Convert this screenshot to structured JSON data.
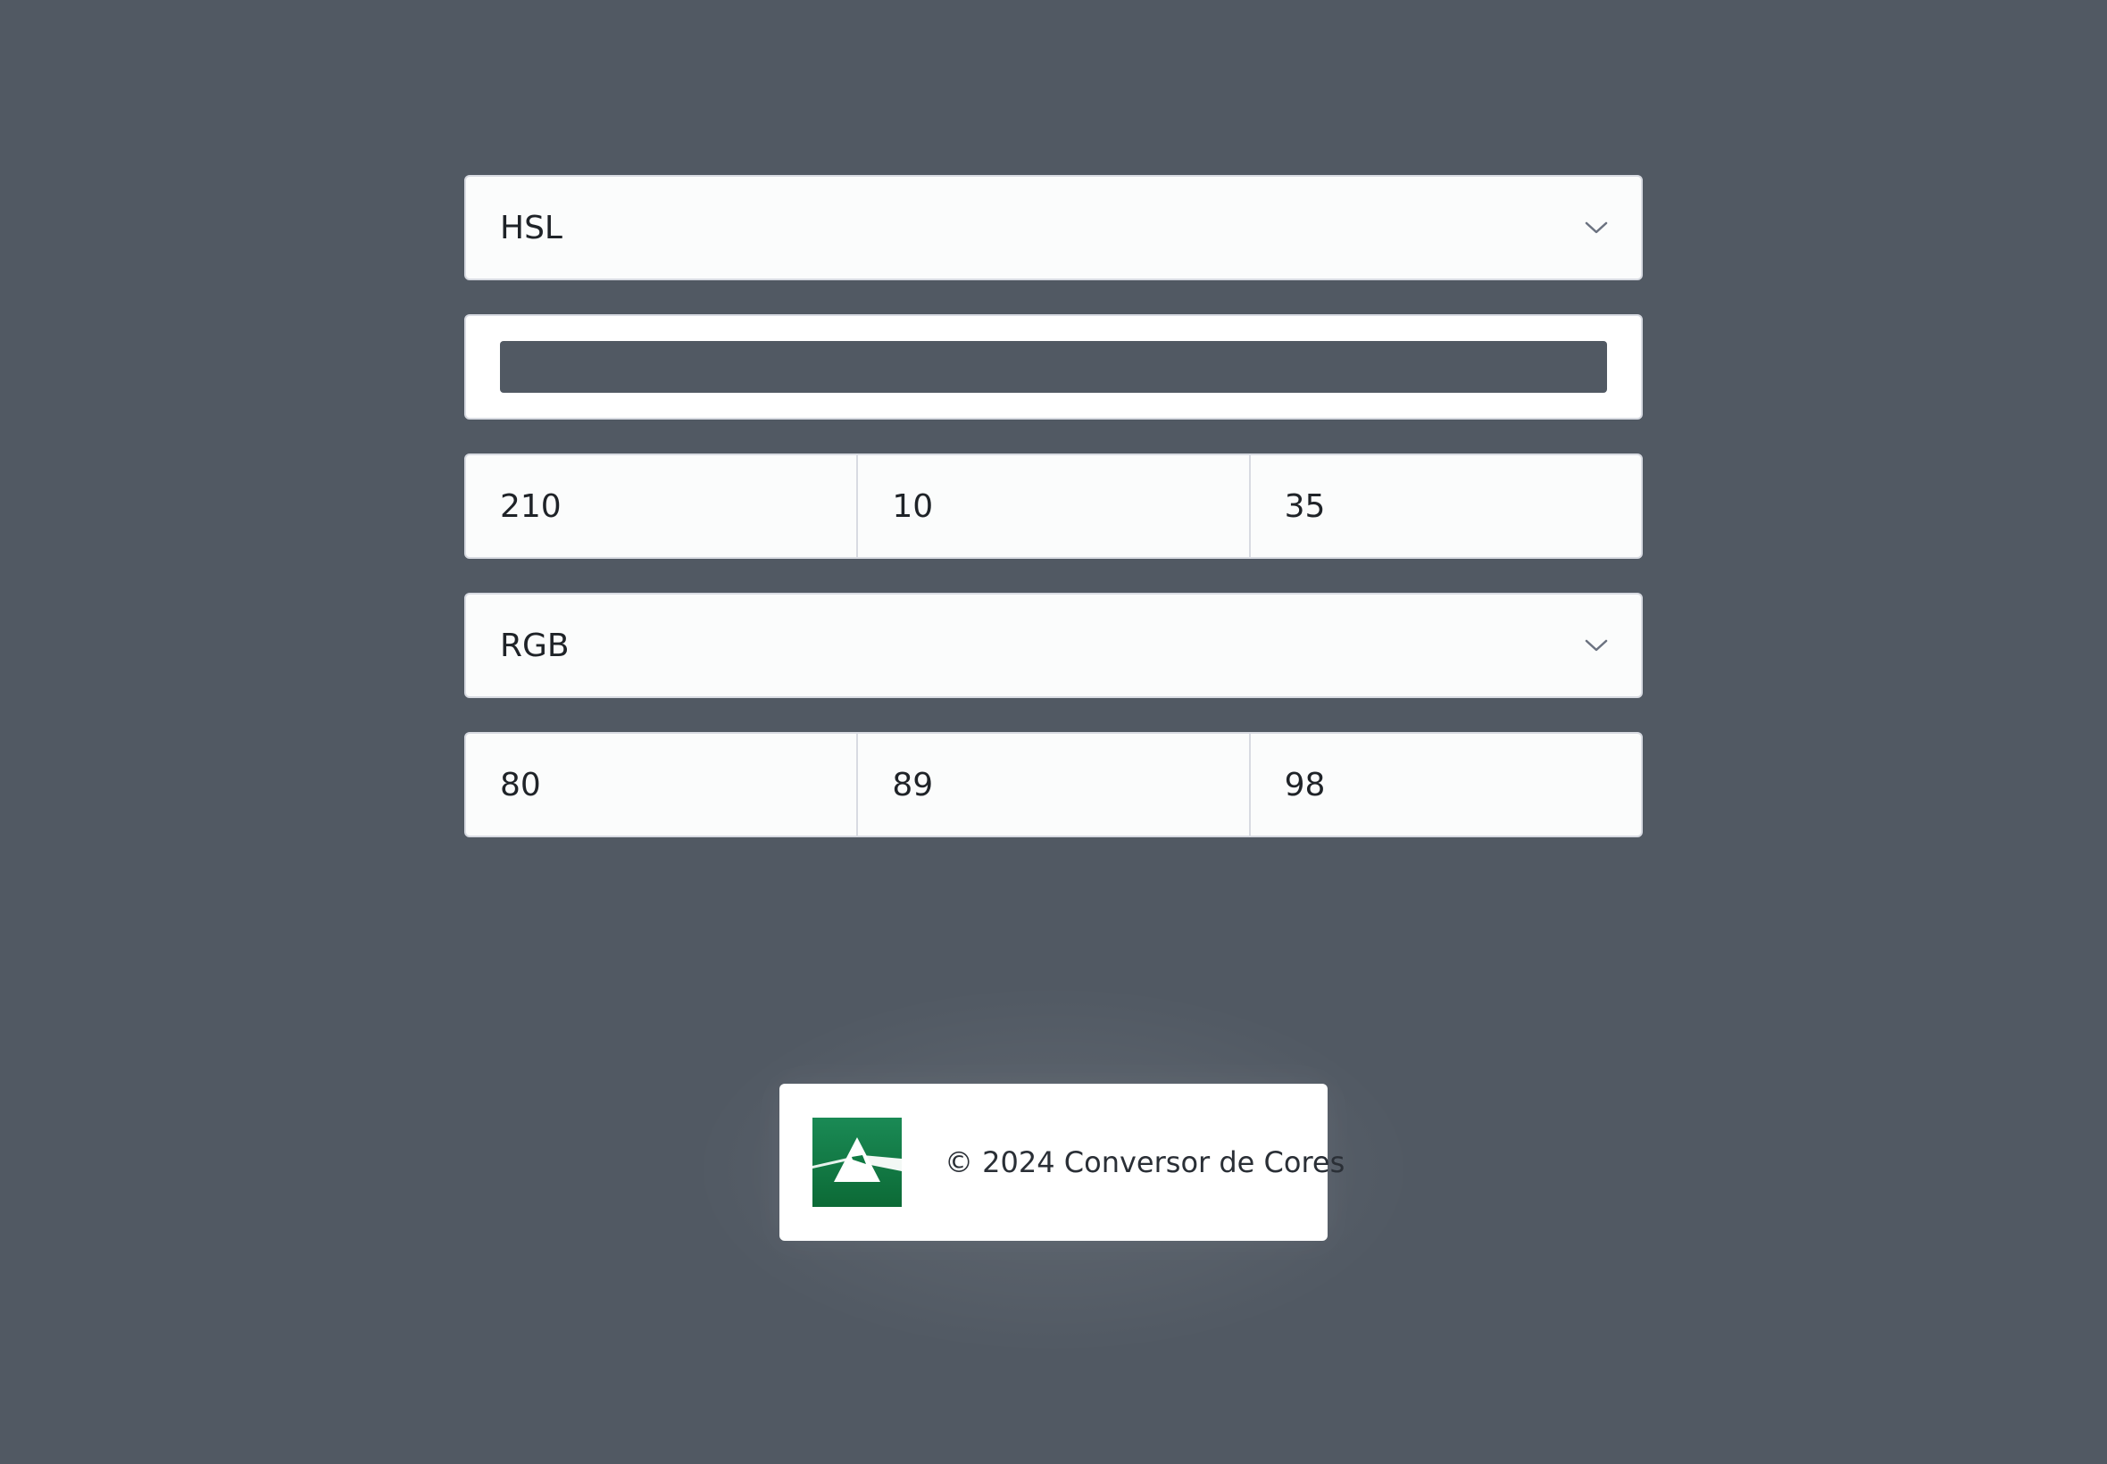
{
  "source_format": {
    "selected": "HSL"
  },
  "preview": {
    "color": "#515963"
  },
  "source_values": [
    "210",
    "10",
    "35"
  ],
  "target_format": {
    "selected": "RGB"
  },
  "target_values": [
    "80",
    "89",
    "98"
  ],
  "footer": {
    "copyright": "© 2024 Conversor de Cores",
    "logo_icon": "prism-logo-icon",
    "logo_color": "#0f7a43"
  },
  "colors": {
    "background": "#515963",
    "panel": "#fbfcfc",
    "border": "#d8dbe2",
    "text": "#1f2328"
  }
}
